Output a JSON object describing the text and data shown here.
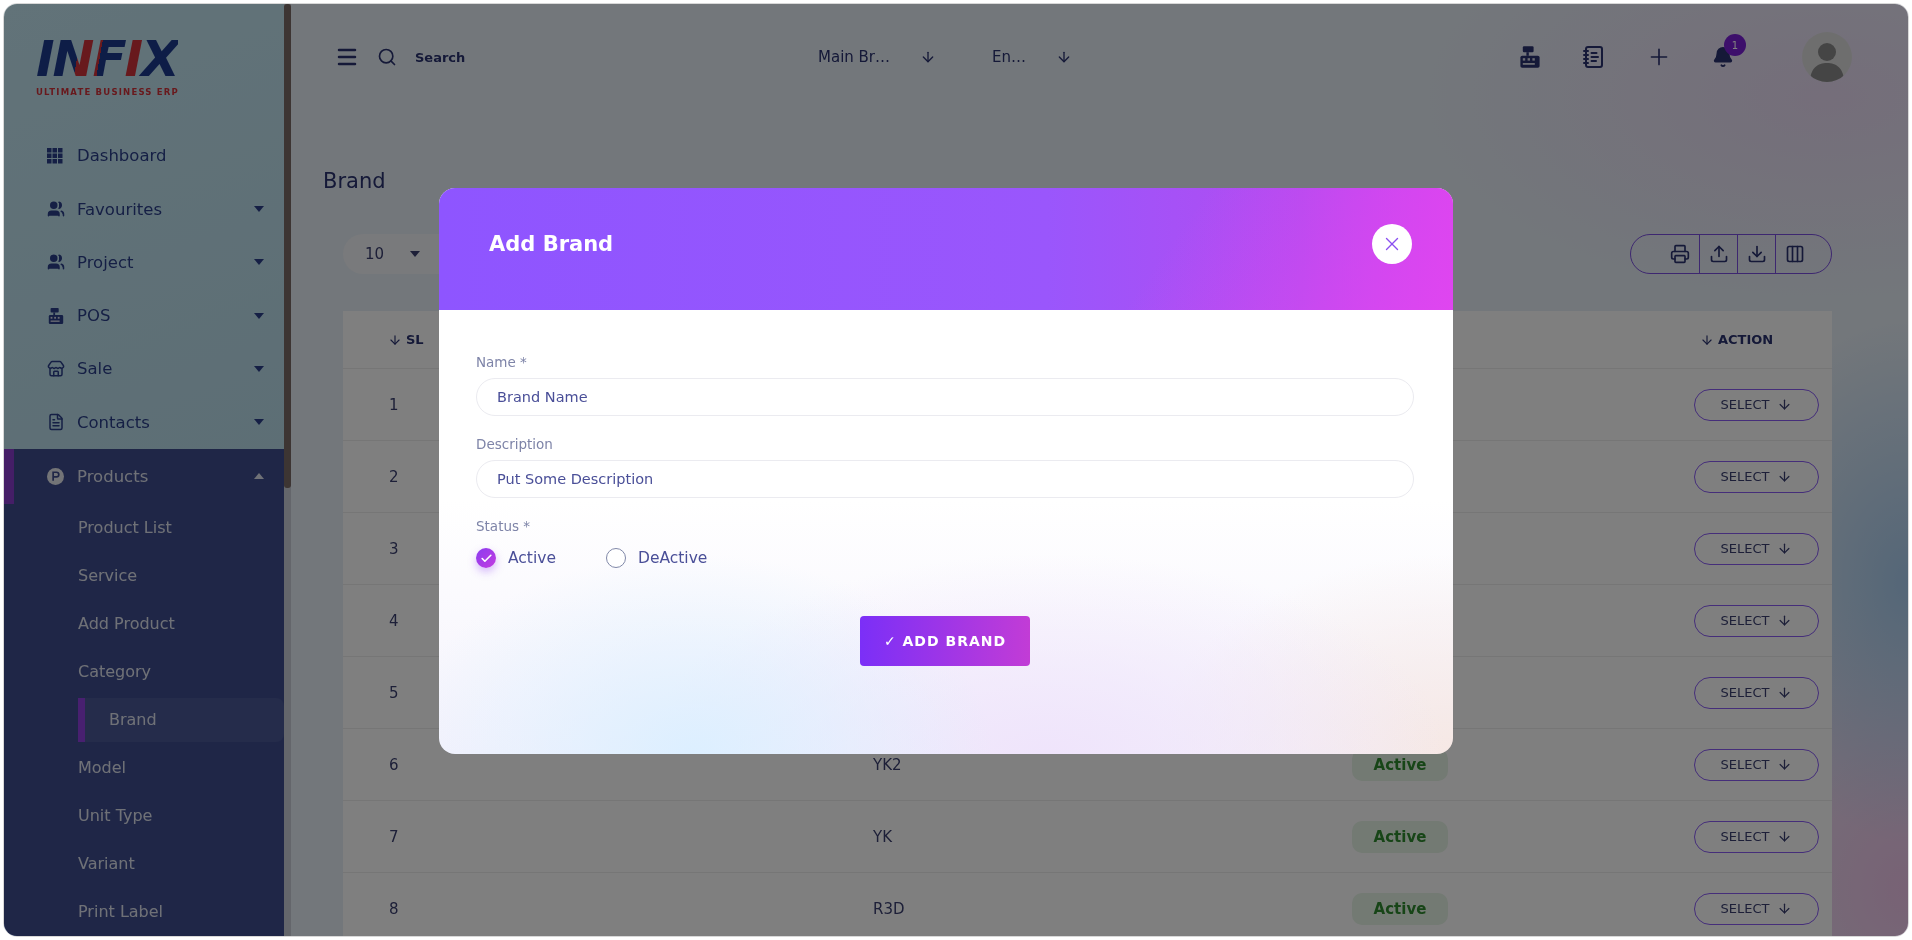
{
  "sidebar": {
    "logo": {
      "title": "INFIX",
      "subtitle": "ULTIMATE BUSINESS ERP"
    },
    "items": [
      {
        "label": "Dashboard",
        "selected": false
      },
      {
        "label": "Favourites",
        "selected": false,
        "expanded": false
      },
      {
        "label": "Project",
        "selected": false,
        "expanded": false
      },
      {
        "label": "POS",
        "selected": false,
        "expanded": false
      },
      {
        "label": "Sale",
        "selected": false,
        "expanded": false
      },
      {
        "label": "Contacts",
        "selected": false,
        "expanded": false
      },
      {
        "label": "Products",
        "selected": true,
        "expanded": true,
        "children": [
          {
            "label": "Product List",
            "selected": false
          },
          {
            "label": "Service",
            "selected": false
          },
          {
            "label": "Add Product",
            "selected": false
          },
          {
            "label": "Category",
            "selected": false
          },
          {
            "label": "Brand",
            "selected": true
          },
          {
            "label": "Model",
            "selected": false
          },
          {
            "label": "Unit Type",
            "selected": false
          },
          {
            "label": "Variant",
            "selected": false
          },
          {
            "label": "Print Label",
            "selected": false
          }
        ]
      }
    ]
  },
  "topbar": {
    "search": {
      "placeholder": "Search"
    },
    "selectors": [
      {
        "value": "Main Br…"
      },
      {
        "value": "En…"
      }
    ],
    "notification_count": "1"
  },
  "page": {
    "title": "Brand",
    "page_size": "10"
  },
  "table": {
    "header": {
      "sl": "SL",
      "action": "ACTION"
    },
    "rows": [
      {
        "sl": "1",
        "action": "SELECT"
      },
      {
        "sl": "2",
        "action": "SELECT"
      },
      {
        "sl": "3",
        "action": "SELECT"
      },
      {
        "sl": "4",
        "action": "SELECT"
      },
      {
        "sl": "5",
        "action": "SELECT"
      },
      {
        "sl": "6",
        "name": "YK2",
        "status": "Active",
        "action": "SELECT"
      },
      {
        "sl": "7",
        "name": "YK",
        "status": "Active",
        "action": "SELECT"
      },
      {
        "sl": "8",
        "name": "R3D",
        "status": "Active",
        "action": "SELECT"
      }
    ]
  },
  "modal": {
    "title": "Add Brand",
    "fields": [
      {
        "label": "Name *",
        "placeholder": "Brand Name"
      },
      {
        "label": "Description",
        "placeholder": "Put Some Description"
      }
    ],
    "status": {
      "label": "Status *",
      "options": [
        {
          "label": "Active",
          "selected": true
        },
        {
          "label": "DeActive",
          "selected": false
        }
      ]
    },
    "submit": "✓ ADD BRAND"
  }
}
